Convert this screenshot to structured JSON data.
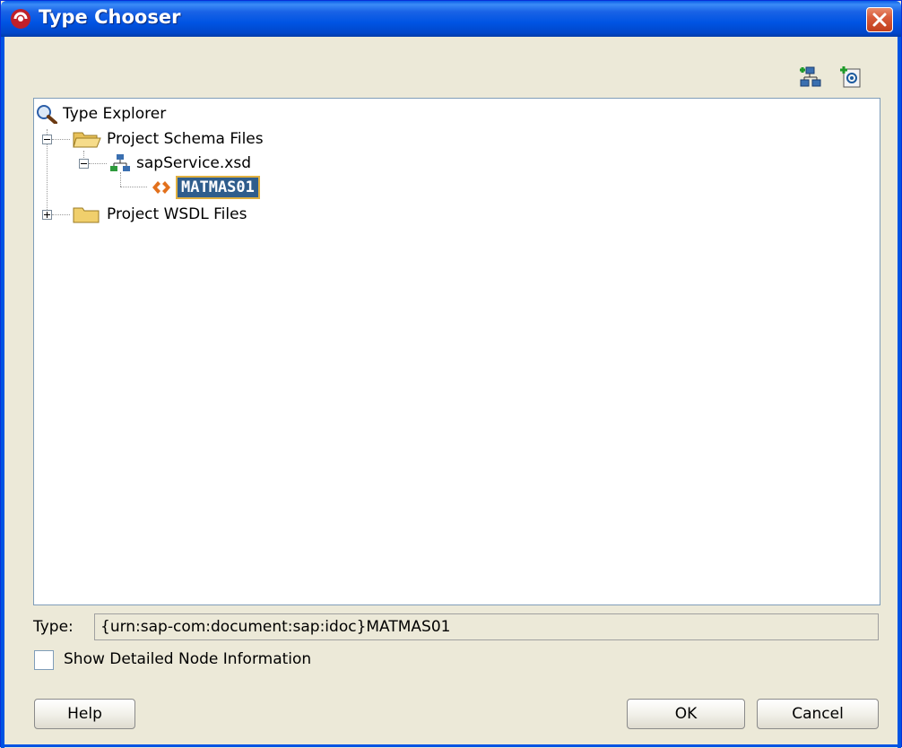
{
  "window": {
    "title": "Type Chooser",
    "accent_color": "#0054e3",
    "close_icon": "close-icon"
  },
  "toolbar": {
    "buttons": [
      {
        "name": "import-schema-icon"
      },
      {
        "name": "import-wsdl-icon"
      }
    ]
  },
  "tree": {
    "root": {
      "label": "Type Explorer",
      "icon": "search-icon"
    },
    "items": [
      {
        "label": "Project Schema Files",
        "icon": "folder-open-icon",
        "expanded": true
      },
      {
        "label": "sapService.xsd",
        "icon": "schema-icon",
        "expanded": true
      },
      {
        "label": "MATMAS01",
        "icon": "element-icon",
        "selected": true
      },
      {
        "label": "Project WSDL Files",
        "icon": "folder-icon",
        "expanded": false
      }
    ],
    "selection_color": "#2f5d8c"
  },
  "type": {
    "label": "Type:",
    "value": "{urn:sap-com:document:sap:idoc}MATMAS01"
  },
  "options": {
    "show_detailed_label": "Show Detailed Node Information",
    "show_detailed_checked": false
  },
  "buttons": {
    "help": "Help",
    "ok": "OK",
    "cancel": "Cancel"
  }
}
